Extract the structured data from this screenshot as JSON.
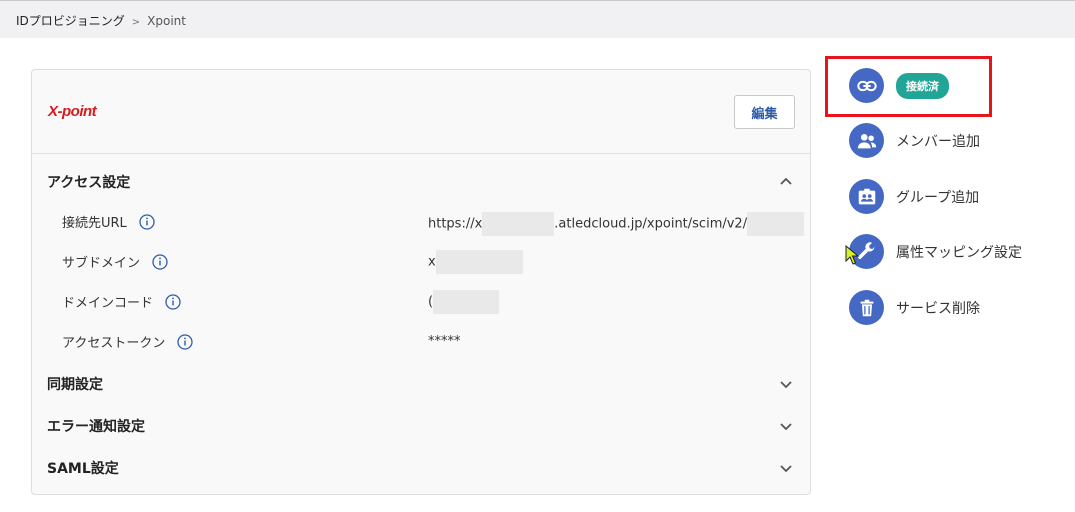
{
  "breadcrumb": {
    "parent": "IDプロビジョニング",
    "separator": ">",
    "current": "Xpoint"
  },
  "card": {
    "logo_text": "X-point",
    "edit_label": "編集",
    "sections": {
      "access": {
        "title": "アクセス設定"
      },
      "sync": {
        "title": "同期設定"
      },
      "error": {
        "title": "エラー通知設定"
      },
      "saml": {
        "title": "SAML設定"
      }
    },
    "rows": {
      "url": {
        "label": "接続先URL",
        "value_prefix": "https://x",
        "value_mid": ".atledcloud.jp/xpoint/scim/v2/"
      },
      "subdomain": {
        "label": "サブドメイン",
        "value": "x"
      },
      "domain_code": {
        "label": "ドメインコード",
        "value": "("
      },
      "token": {
        "label": "アクセストークン",
        "value": "*****"
      }
    }
  },
  "sidebar": {
    "connected_badge": "接続済",
    "add_member": "メンバー追加",
    "add_group": "グループ追加",
    "attr_mapping": "属性マッピング設定",
    "delete_service": "サービス削除"
  },
  "colors": {
    "accent": "#4468c4",
    "badge": "#20a596",
    "highlight": "#e8141b",
    "logo": "#d71920"
  },
  "icons": [
    "link-icon",
    "users-icon",
    "group-card-icon",
    "wrench-icon",
    "trash-icon",
    "info-icon",
    "chevron-up-icon",
    "chevron-down-icon"
  ]
}
